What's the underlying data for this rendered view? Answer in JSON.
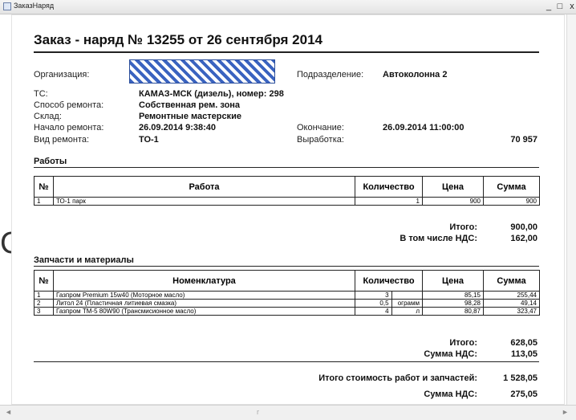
{
  "window": {
    "title": "ЗаказНаряд",
    "minimize_label": "_",
    "maximize_label": "□",
    "close_label": "x"
  },
  "side_char": "С",
  "doc": {
    "title": "Заказ - наряд № 13255 от 26 сентября 2014",
    "fields": {
      "org_label": "Организация:",
      "subdivision_label": "Подразделение:",
      "subdivision_value": "Автоколонна 2",
      "ts_label": "ТС:",
      "ts_value": "КАМАЗ-МСК (дизель), номер: 298",
      "method_label": "Способ ремонта:",
      "method_value": "Собственная рем. зона",
      "warehouse_label": "Склад:",
      "warehouse_value": "Ремонтные мастерские",
      "start_label": "Начало ремонта:",
      "start_value": "26.09.2014 9:38:40",
      "end_label": "Окончание:",
      "end_value": "26.09.2014 11:00:00",
      "type_label": "Вид ремонта:",
      "type_value": "ТО-1",
      "output_label": "Выработка:",
      "output_value": "70 957"
    },
    "works": {
      "section_title": "Работы",
      "headers": [
        "№",
        "Работа",
        "Количество",
        "Цена",
        "Сумма"
      ],
      "rows": [
        {
          "n": "1",
          "name": "ТО-1 парк",
          "qty": "1",
          "price": "900",
          "sum": "900"
        }
      ],
      "total_label": "Итого:",
      "total_value": "900,00",
      "vat_label": "В том числе НДС:",
      "vat_value": "162,00"
    },
    "parts": {
      "section_title": "Запчасти и материалы",
      "headers": [
        "№",
        "Номенклатура",
        "Количество",
        "Цена",
        "Сумма"
      ],
      "rows": [
        {
          "n": "1",
          "name": "Газпром Premium 15w40 (Моторное масло)",
          "qty": "3",
          "unit": "",
          "price": "85,15",
          "sum": "255,44"
        },
        {
          "n": "2",
          "name": "Литол 24 (Пластичная литиевая смазка)",
          "qty": "0,5",
          "unit": "ограмм",
          "price": "98,28",
          "sum": "49,14"
        },
        {
          "n": "3",
          "name": "Газпром  ТМ-5  80W90 (Трансмисионное масло)",
          "qty": "4",
          "unit": "л",
          "price": "80,87",
          "sum": "323,47"
        }
      ],
      "total_label": "Итого:",
      "total_value": "628,05",
      "vat_label": "Сумма НДС:",
      "vat_value": "113,05"
    },
    "grand": {
      "total_label": "Итого стоимость работ и запчастей:",
      "total_value": "1 528,05",
      "vat_label": "Сумма НДС:",
      "vat_value": "275,05"
    }
  },
  "scrollbar": {
    "left_arrow": "◄",
    "right_arrow": "►",
    "thumb_mark": "r"
  }
}
